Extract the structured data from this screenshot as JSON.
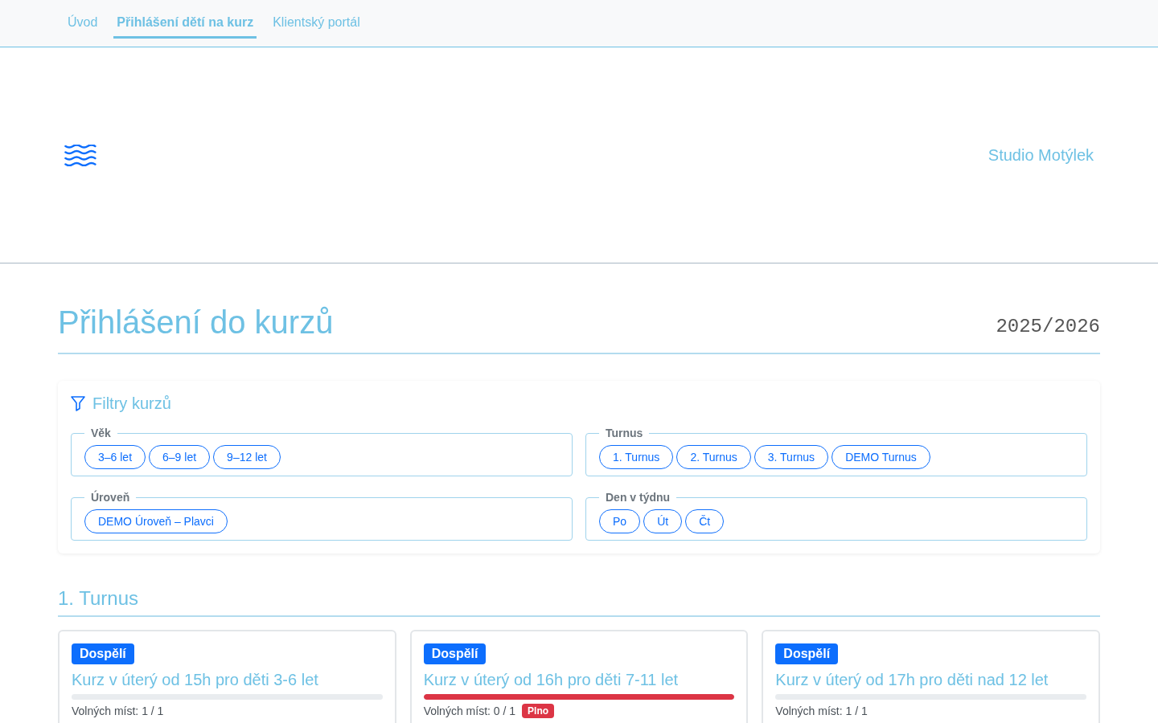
{
  "nav": {
    "tabs": [
      {
        "label": "Úvod",
        "selected": false
      },
      {
        "label": "Přihlášení dětí na kurz",
        "selected": true
      },
      {
        "label": "Klientský portál",
        "selected": false
      }
    ]
  },
  "header": {
    "brand": "Studio Motýlek"
  },
  "page": {
    "title": "Přihlášení do kurzů",
    "season": "2025/2026"
  },
  "filters": {
    "title": "Filtry kurzů",
    "groups": [
      {
        "legend": "Věk",
        "options": [
          {
            "label": "3–6 let",
            "selected": false
          },
          {
            "label": "6–9 let",
            "selected": false
          },
          {
            "label": "9–12 let",
            "selected": false
          }
        ]
      },
      {
        "legend": "Turnus",
        "options": [
          {
            "label": "1. Turnus",
            "selected": false
          },
          {
            "label": "2. Turnus",
            "selected": false
          },
          {
            "label": "3. Turnus",
            "selected": false
          },
          {
            "label": "DEMO Turnus",
            "selected": false
          }
        ]
      },
      {
        "legend": "Úroveň",
        "options": [
          {
            "label": "DEMO Úroveň – Plavci",
            "selected": false
          }
        ]
      },
      {
        "legend": "Den v týdnu",
        "options": [
          {
            "label": "Po",
            "selected": false
          },
          {
            "label": "Út",
            "selected": false
          },
          {
            "label": "Čt",
            "selected": false
          }
        ]
      }
    ]
  },
  "sections": [
    {
      "title": "1. Turnus",
      "courses": [
        {
          "tag": "Dospělí",
          "title": "Kurz v úterý od 15h pro děti 3-6 let",
          "level": 0,
          "availability": "Volných míst: 1 / 1"
        },
        {
          "tag": "Dospělí",
          "title": "Kurz v úterý od 16h pro děti 7-11 let",
          "level": 1,
          "availability": "Volných míst: 0 / 1",
          "status": "Plno"
        },
        {
          "tag": "Dospělí",
          "title": "Kurz v úterý od 17h pro děti nad 12 let",
          "level": 0,
          "availability": "Volných míst: 1 / 1"
        }
      ]
    }
  ]
}
